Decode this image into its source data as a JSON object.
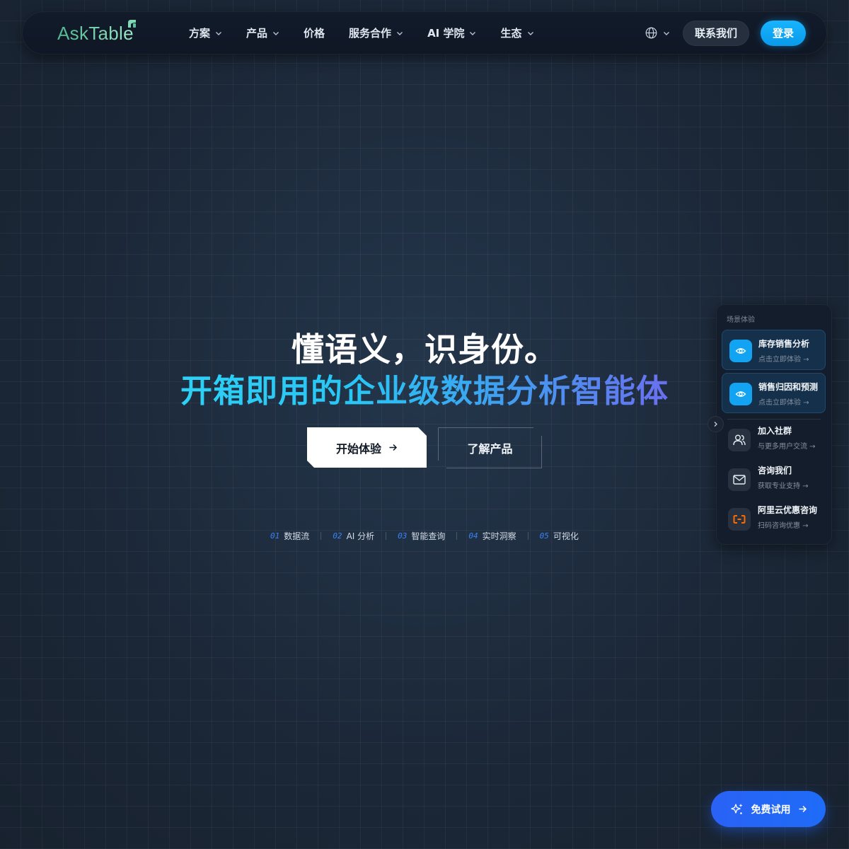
{
  "brand": {
    "name": "AskTable"
  },
  "nav": {
    "items": [
      {
        "label": "方案",
        "has_dropdown": true
      },
      {
        "label": "产品",
        "has_dropdown": true
      },
      {
        "label": "价格",
        "has_dropdown": false
      },
      {
        "label": "服务合作",
        "has_dropdown": true
      },
      {
        "label": "AI 学院",
        "has_dropdown": true
      },
      {
        "label": "生态",
        "has_dropdown": true
      }
    ],
    "language_icon": "globe-icon",
    "contact_label": "联系我们",
    "login_label": "登录"
  },
  "hero": {
    "title": "懂语义，识身份。",
    "subtitle": "开箱即用的企业级数据分析智能体",
    "primary_cta": "开始体验",
    "secondary_cta": "了解产品",
    "steps": [
      {
        "num": "01",
        "label": "数据流"
      },
      {
        "num": "02",
        "label": "AI 分析"
      },
      {
        "num": "03",
        "label": "智能查询"
      },
      {
        "num": "04",
        "label": "实时洞察"
      },
      {
        "num": "05",
        "label": "可视化"
      }
    ]
  },
  "side_panel": {
    "heading": "场景体验",
    "scenes": [
      {
        "title": "库存销售分析",
        "sub": "点击立即体验 →",
        "icon": "eye-icon"
      },
      {
        "title": "销售归因和预测",
        "sub": "点击立即体验 →",
        "icon": "eye-icon"
      }
    ],
    "links": [
      {
        "title": "加入社群",
        "sub": "与更多用户交流 →",
        "icon": "users-icon"
      },
      {
        "title": "咨询我们",
        "sub": "获取专业支持 →",
        "icon": "mail-icon"
      },
      {
        "title": "阿里云优惠咨询",
        "sub": "扫码咨询优惠 →",
        "icon": "aliyun-icon"
      }
    ]
  },
  "floating": {
    "trial_label": "免费试用",
    "icon": "sparkle-icon"
  },
  "colors": {
    "accent": "#12a4f3",
    "cta_blue": "#2a62f5",
    "brand_green": "#6fd1a8",
    "aliyun_orange": "#ff6a00"
  }
}
